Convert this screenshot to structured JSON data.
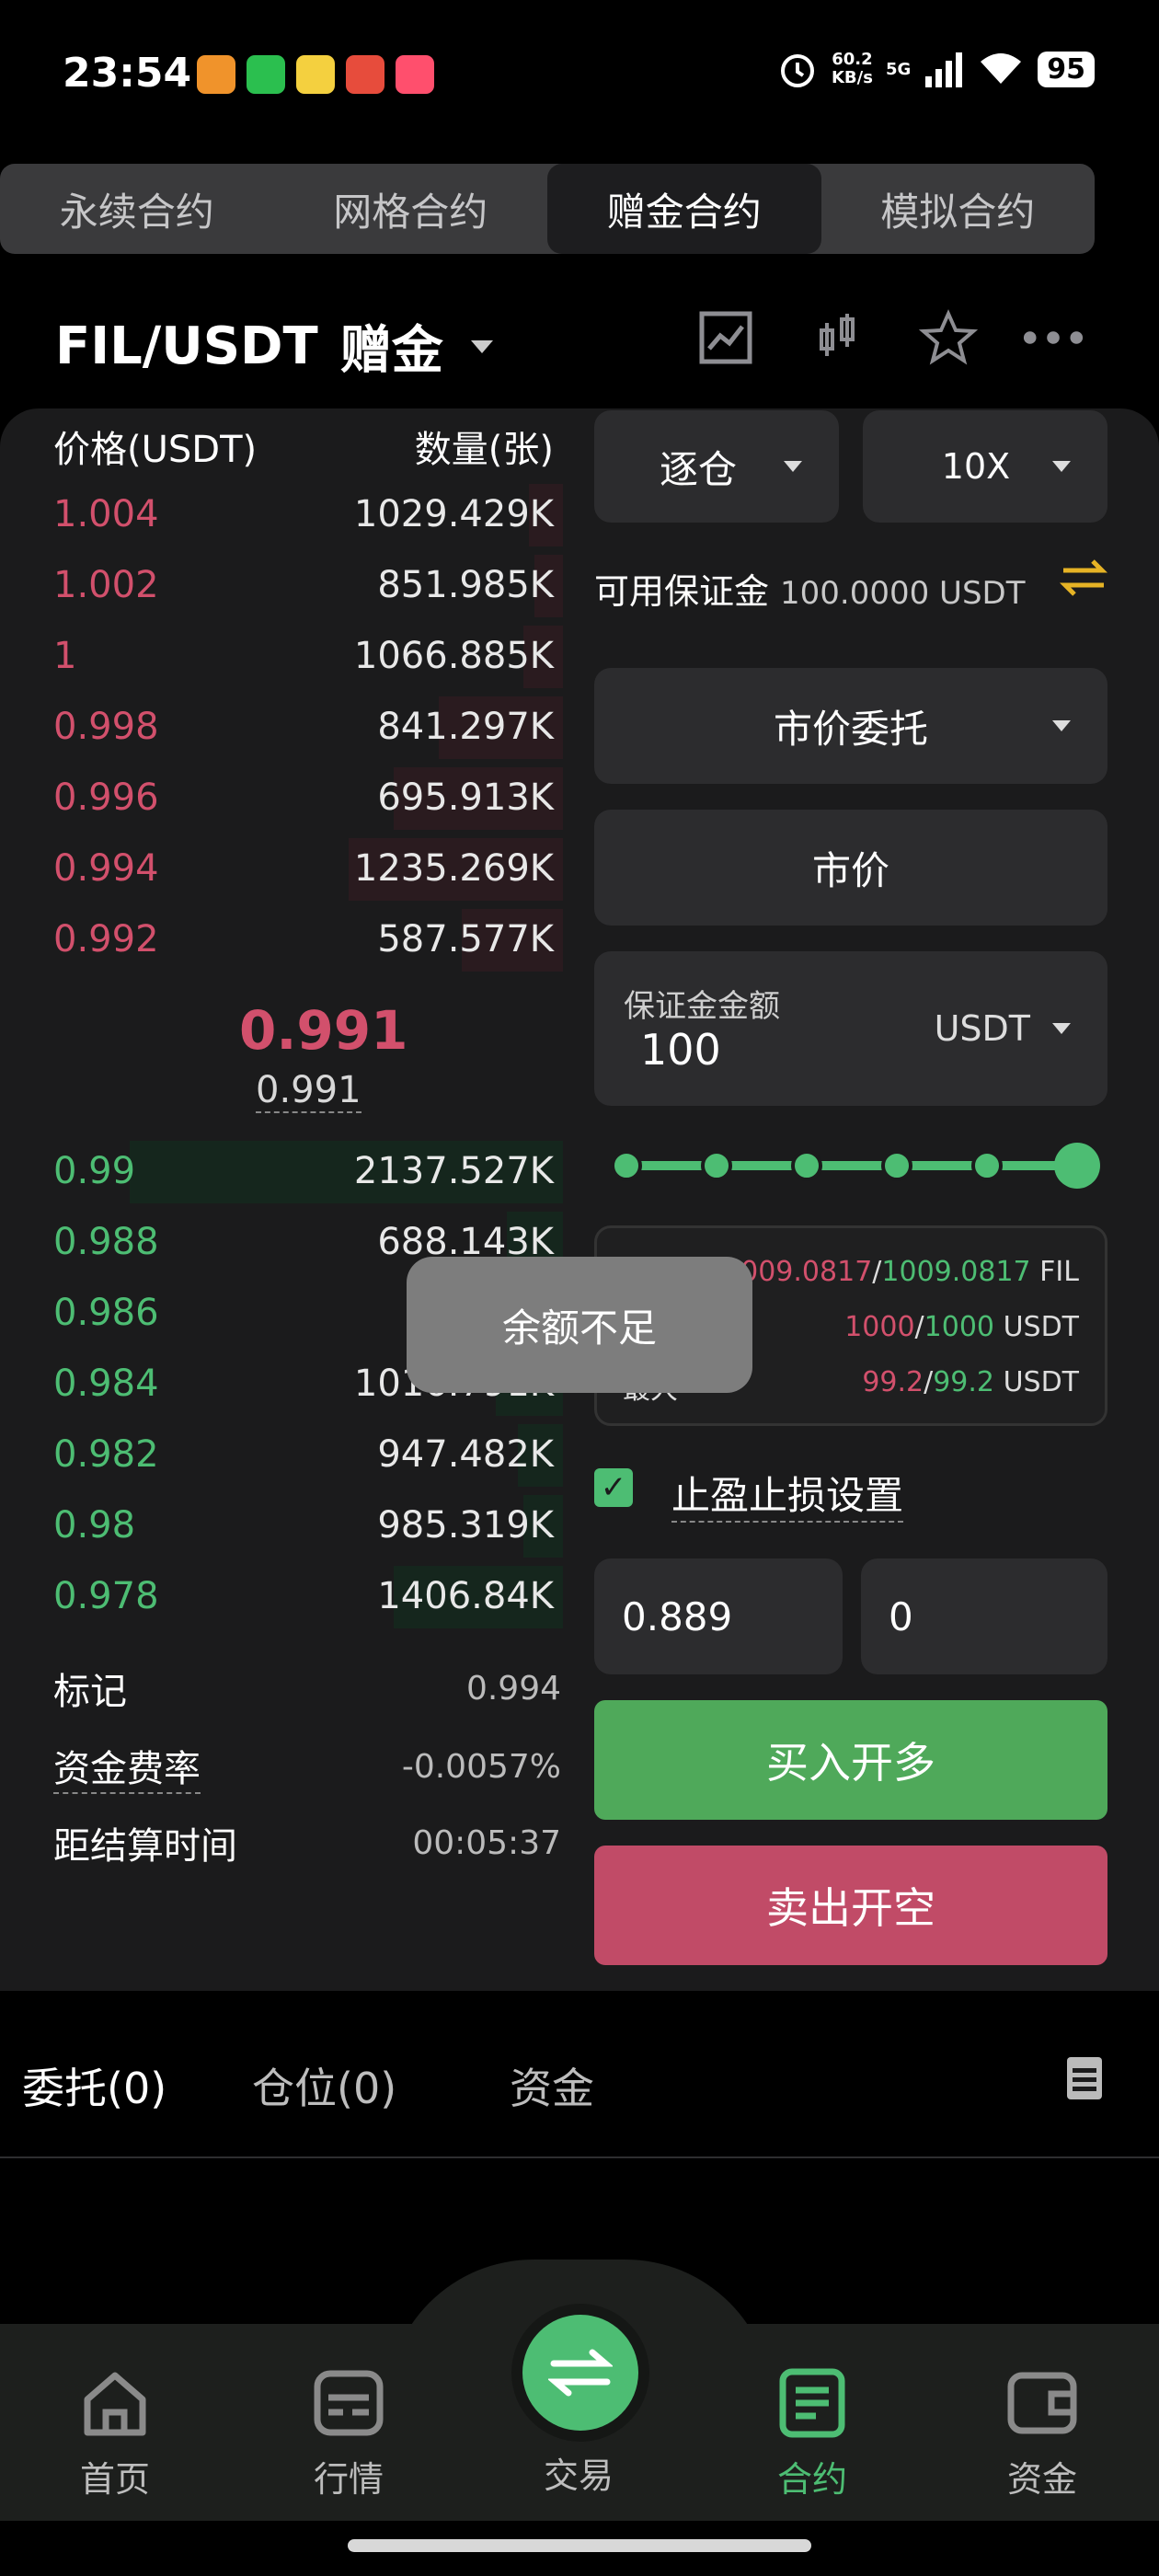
{
  "status_bar": {
    "time": "23:54",
    "net_speed_value": "60.2",
    "net_speed_unit": "KB/s",
    "signal": "5G",
    "battery": "95"
  },
  "top_tabs": [
    "永续合约",
    "网格合约",
    "赠金合约",
    "模拟合约"
  ],
  "header": {
    "pair": "FIL/USDT",
    "mode": "赠金"
  },
  "orderbook": {
    "price_header": "价格(USDT)",
    "qty_header": "数量(张)",
    "asks": [
      {
        "price": "1.004",
        "qty": "1029.429K",
        "depth": 0.06
      },
      {
        "price": "1.002",
        "qty": "851.985K",
        "depth": 0.05
      },
      {
        "price": "1",
        "qty": "1066.885K",
        "depth": 0.07
      },
      {
        "price": "0.998",
        "qty": "841.297K",
        "depth": 0.22
      },
      {
        "price": "0.996",
        "qty": "695.913K",
        "depth": 0.3
      },
      {
        "price": "0.994",
        "qty": "1235.269K",
        "depth": 0.38
      },
      {
        "price": "0.992",
        "qty": "587.577K",
        "depth": 0.18
      }
    ],
    "last_price": "0.991",
    "mark_sub": "0.991",
    "bids": [
      {
        "price": "0.99",
        "qty": "2137.527K",
        "depth": 0.77
      },
      {
        "price": "0.988",
        "qty": "688.143K",
        "depth": 0.1
      },
      {
        "price": "0.986",
        "qty": "71",
        "depth": 0.06
      },
      {
        "price": "0.984",
        "qty": "1016.791K",
        "depth": 0.12
      },
      {
        "price": "0.982",
        "qty": "947.482K",
        "depth": 0.08
      },
      {
        "price": "0.98",
        "qty": "985.319K",
        "depth": 0.07
      },
      {
        "price": "0.978",
        "qty": "1406.84K",
        "depth": 0.3
      }
    ],
    "mark_label": "标记",
    "mark_value": "0.994",
    "funding_label": "资金费率",
    "funding_value": "-0.0057%",
    "settle_label": "距结算时间",
    "settle_value": "00:05:37"
  },
  "form": {
    "margin_mode": "逐仓",
    "leverage": "10X",
    "available_label": "可用保证金",
    "available_value": "100.0000 USDT",
    "order_type": "市价委托",
    "price_type": "市价",
    "margin_amount_label": "保证金金额",
    "margin_amount_value": "100",
    "currency": "USDT",
    "slider_percent": 100,
    "box": {
      "line1_a": "1009.0817",
      "line1_b": "1009.0817",
      "line1_unit": "FIL",
      "line2_a": "1000",
      "line2_b": "1000",
      "line2_unit": "USDT",
      "line3_left": "最大",
      "line3_a": "99.2",
      "line3_b": "99.2",
      "line3_unit": "USDT"
    },
    "tpsl_label": "止盈止损设置",
    "tp_value": "0.889",
    "sl_value": "0",
    "buy_label": "买入开多",
    "sell_label": "卖出开空"
  },
  "toast": "余额不足",
  "bottom_tabs": [
    "委托(0)",
    "仓位(0)",
    "资金"
  ],
  "nav": [
    "首页",
    "行情",
    "交易",
    "合约",
    "资金"
  ],
  "colors": {
    "green": "#4dbd73",
    "red": "#d2506c",
    "buy": "#4fa95a",
    "sell": "#c14b67"
  }
}
